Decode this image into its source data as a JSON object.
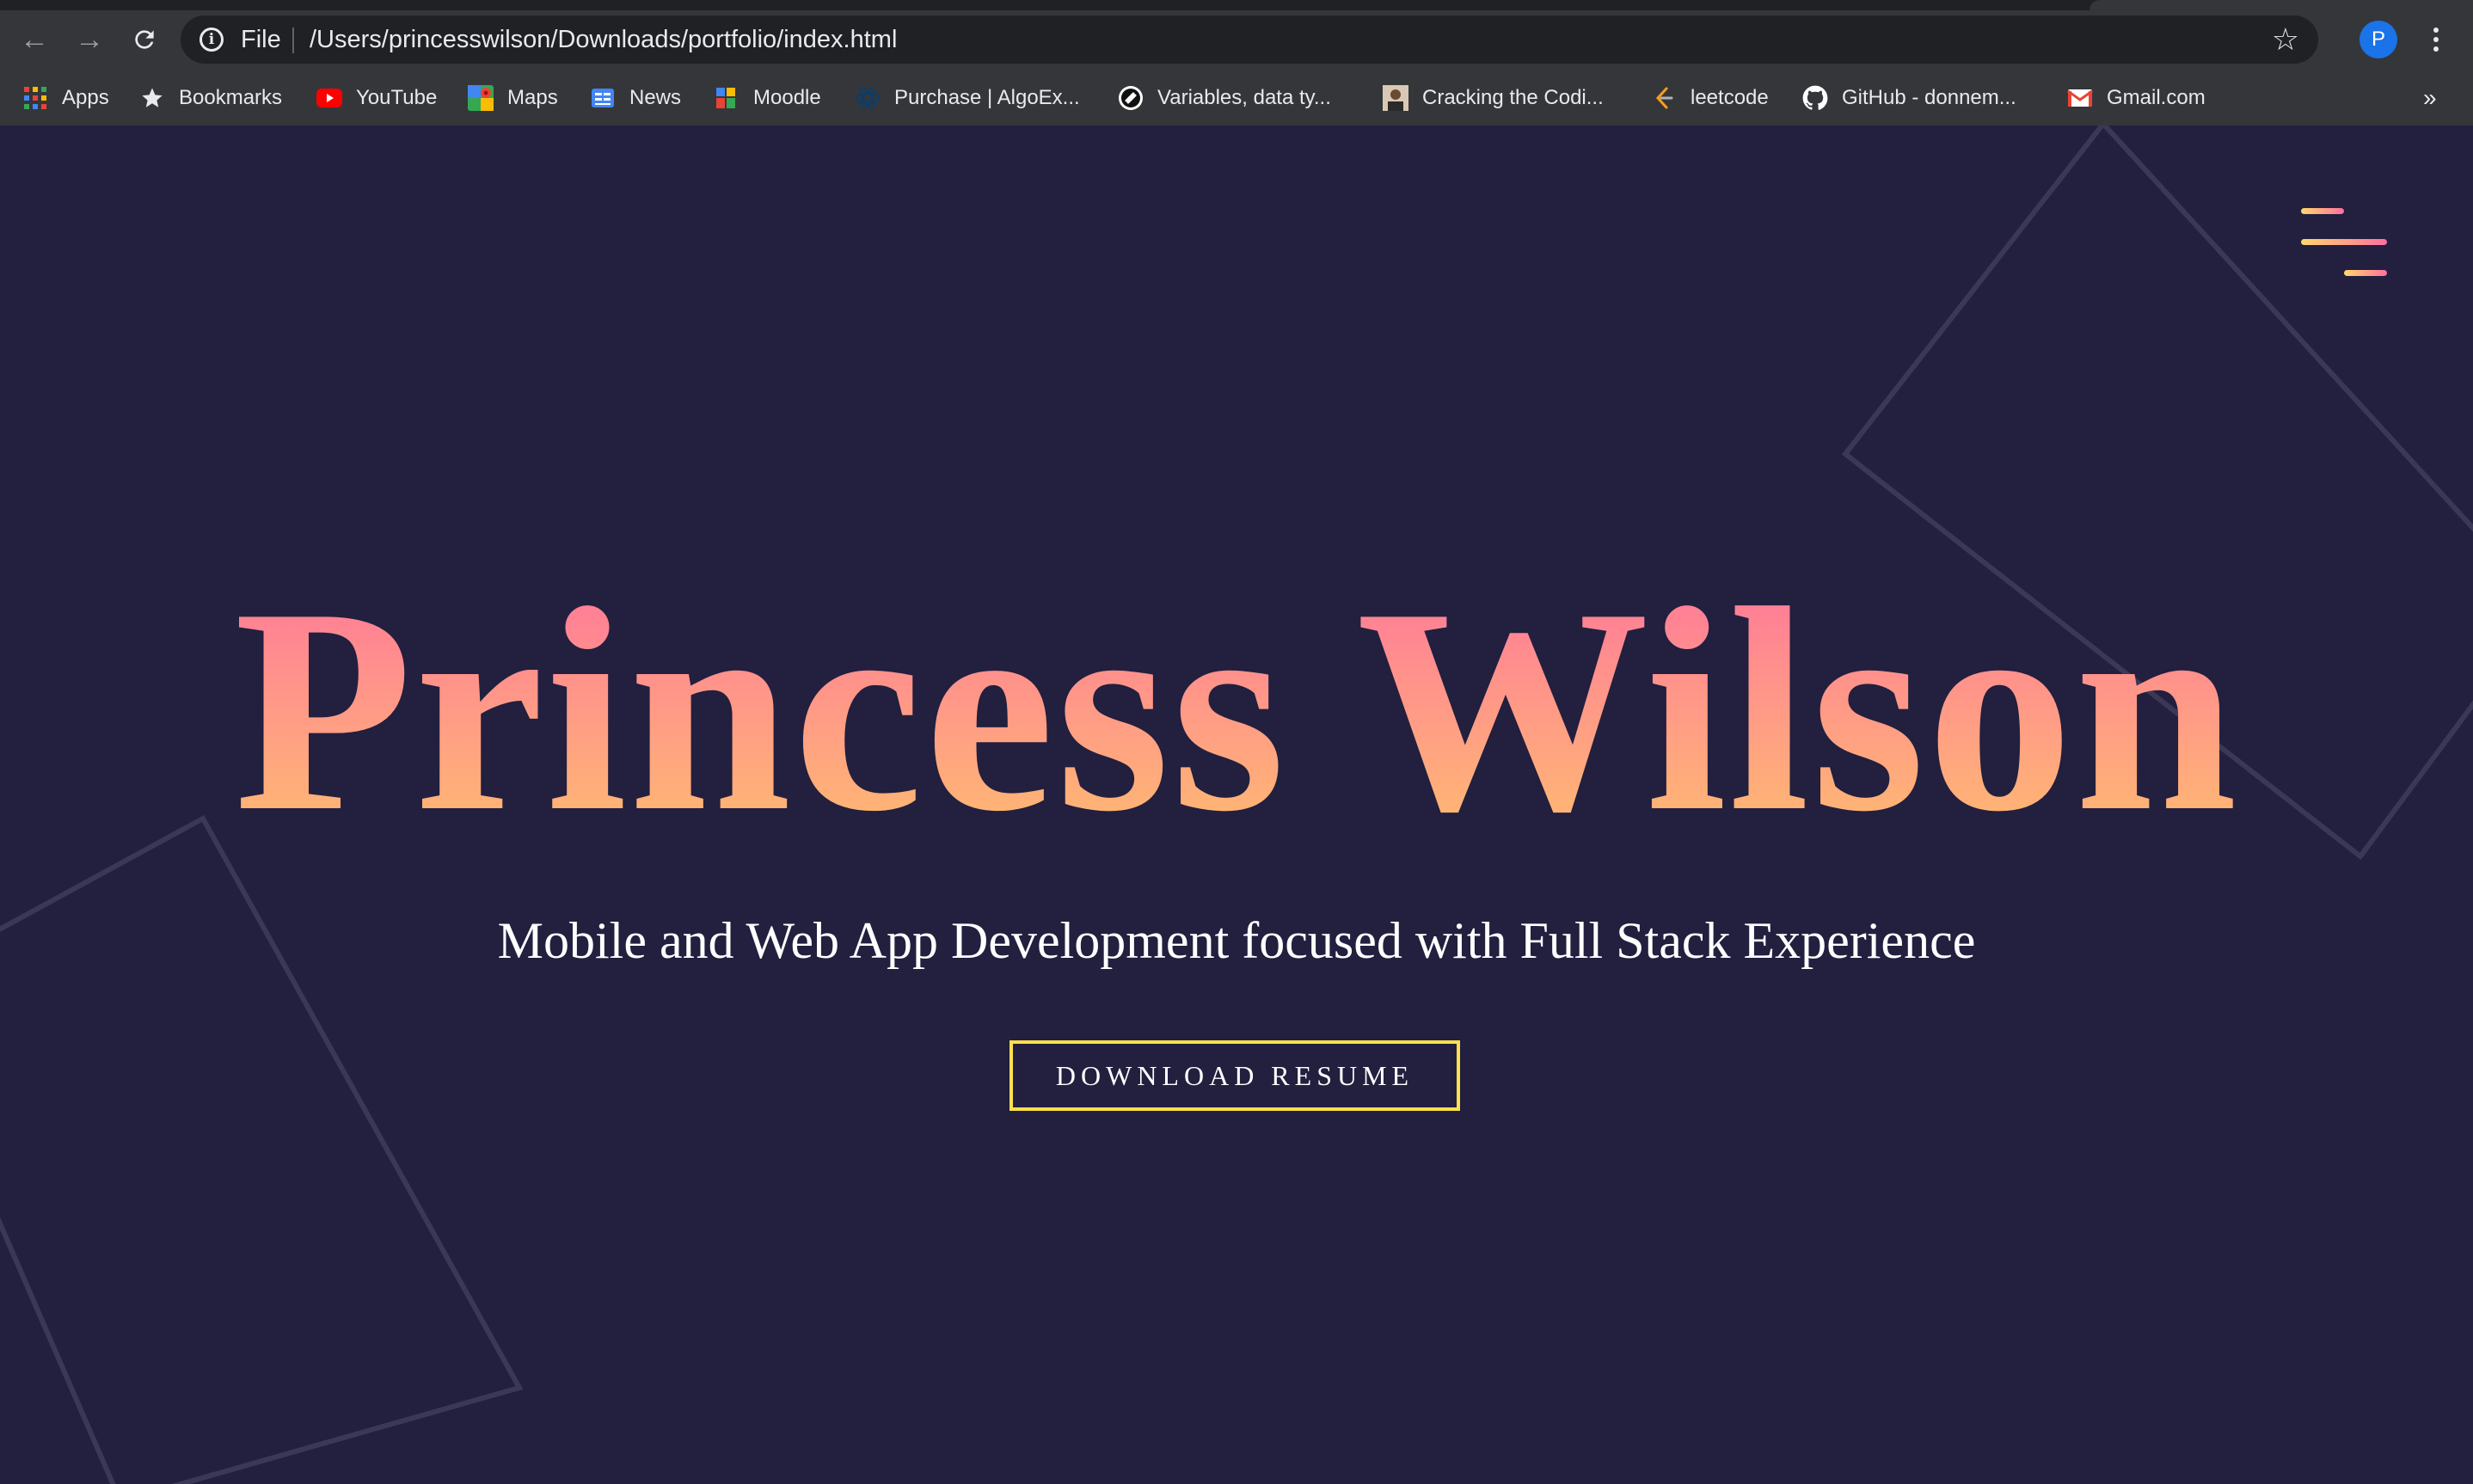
{
  "browser": {
    "scheme_label": "File",
    "url": "/Users/princesswilson/Downloads/portfolio/index.html",
    "profile_initial": "P",
    "overflow_label": "»"
  },
  "bookmarks": [
    {
      "label": "Apps",
      "icon": "apps-grid-icon"
    },
    {
      "label": "Bookmarks",
      "icon": "star-icon"
    },
    {
      "label": "YouTube",
      "icon": "youtube-icon"
    },
    {
      "label": "Maps",
      "icon": "maps-icon"
    },
    {
      "label": "News",
      "icon": "google-news-icon"
    },
    {
      "label": "Moodle",
      "icon": "moodle-icon"
    },
    {
      "label": "Purchase | AlgoEx...",
      "icon": "algoexpert-icon"
    },
    {
      "label": "Variables, data ty...",
      "icon": "site-favicon-icon"
    },
    {
      "label": "Cracking the Codi...",
      "icon": "avatar-favicon-icon"
    },
    {
      "label": "leetcode",
      "icon": "leetcode-icon"
    },
    {
      "label": "GitHub - donnem...",
      "icon": "github-icon"
    },
    {
      "label": "Gmail.com",
      "icon": "gmail-icon"
    }
  ],
  "hero": {
    "title": "Princess Wilson",
    "subtitle": "Mobile and Web App Development focused with Full Stack Experience",
    "button_label": "DOWNLOAD RESUME"
  },
  "colors": {
    "background": "#221f3f",
    "accent_pink": "#ff6f9f",
    "accent_yellow": "#ffc56a",
    "button_border": "#ffe04d"
  }
}
